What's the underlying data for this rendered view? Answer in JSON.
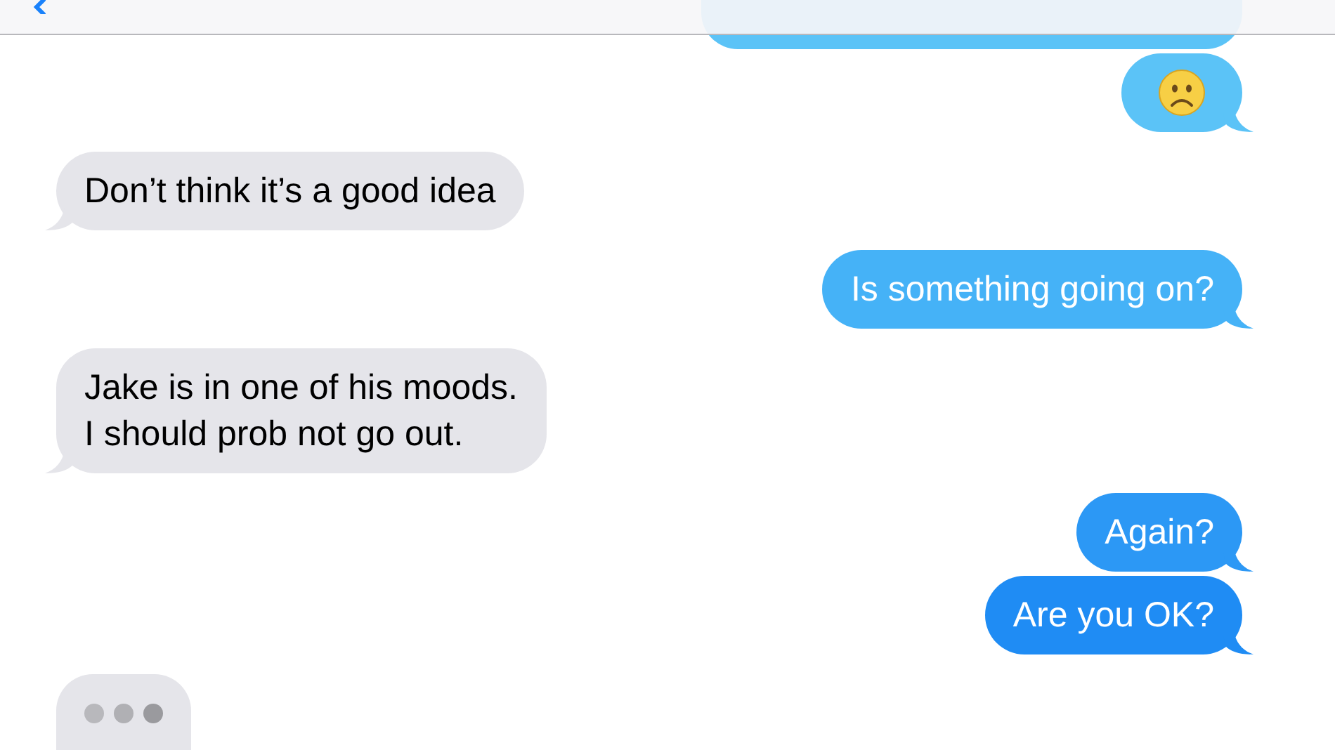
{
  "messages": [
    {
      "outgoing": true,
      "kind": "cut_off"
    },
    {
      "outgoing": true,
      "kind": "emoji"
    },
    {
      "outgoing": false,
      "kind": "text",
      "text": "Don’t think it’s a good idea"
    },
    {
      "outgoing": true,
      "kind": "text",
      "text": "Is something going on?"
    },
    {
      "outgoing": false,
      "kind": "text",
      "text": "Jake is in one of his moods.\nI should prob not go out."
    },
    {
      "outgoing": true,
      "kind": "text",
      "text": "Again?"
    },
    {
      "outgoing": true,
      "kind": "text",
      "text": "Are you OK?"
    },
    {
      "outgoing": false,
      "kind": "typing"
    }
  ]
}
